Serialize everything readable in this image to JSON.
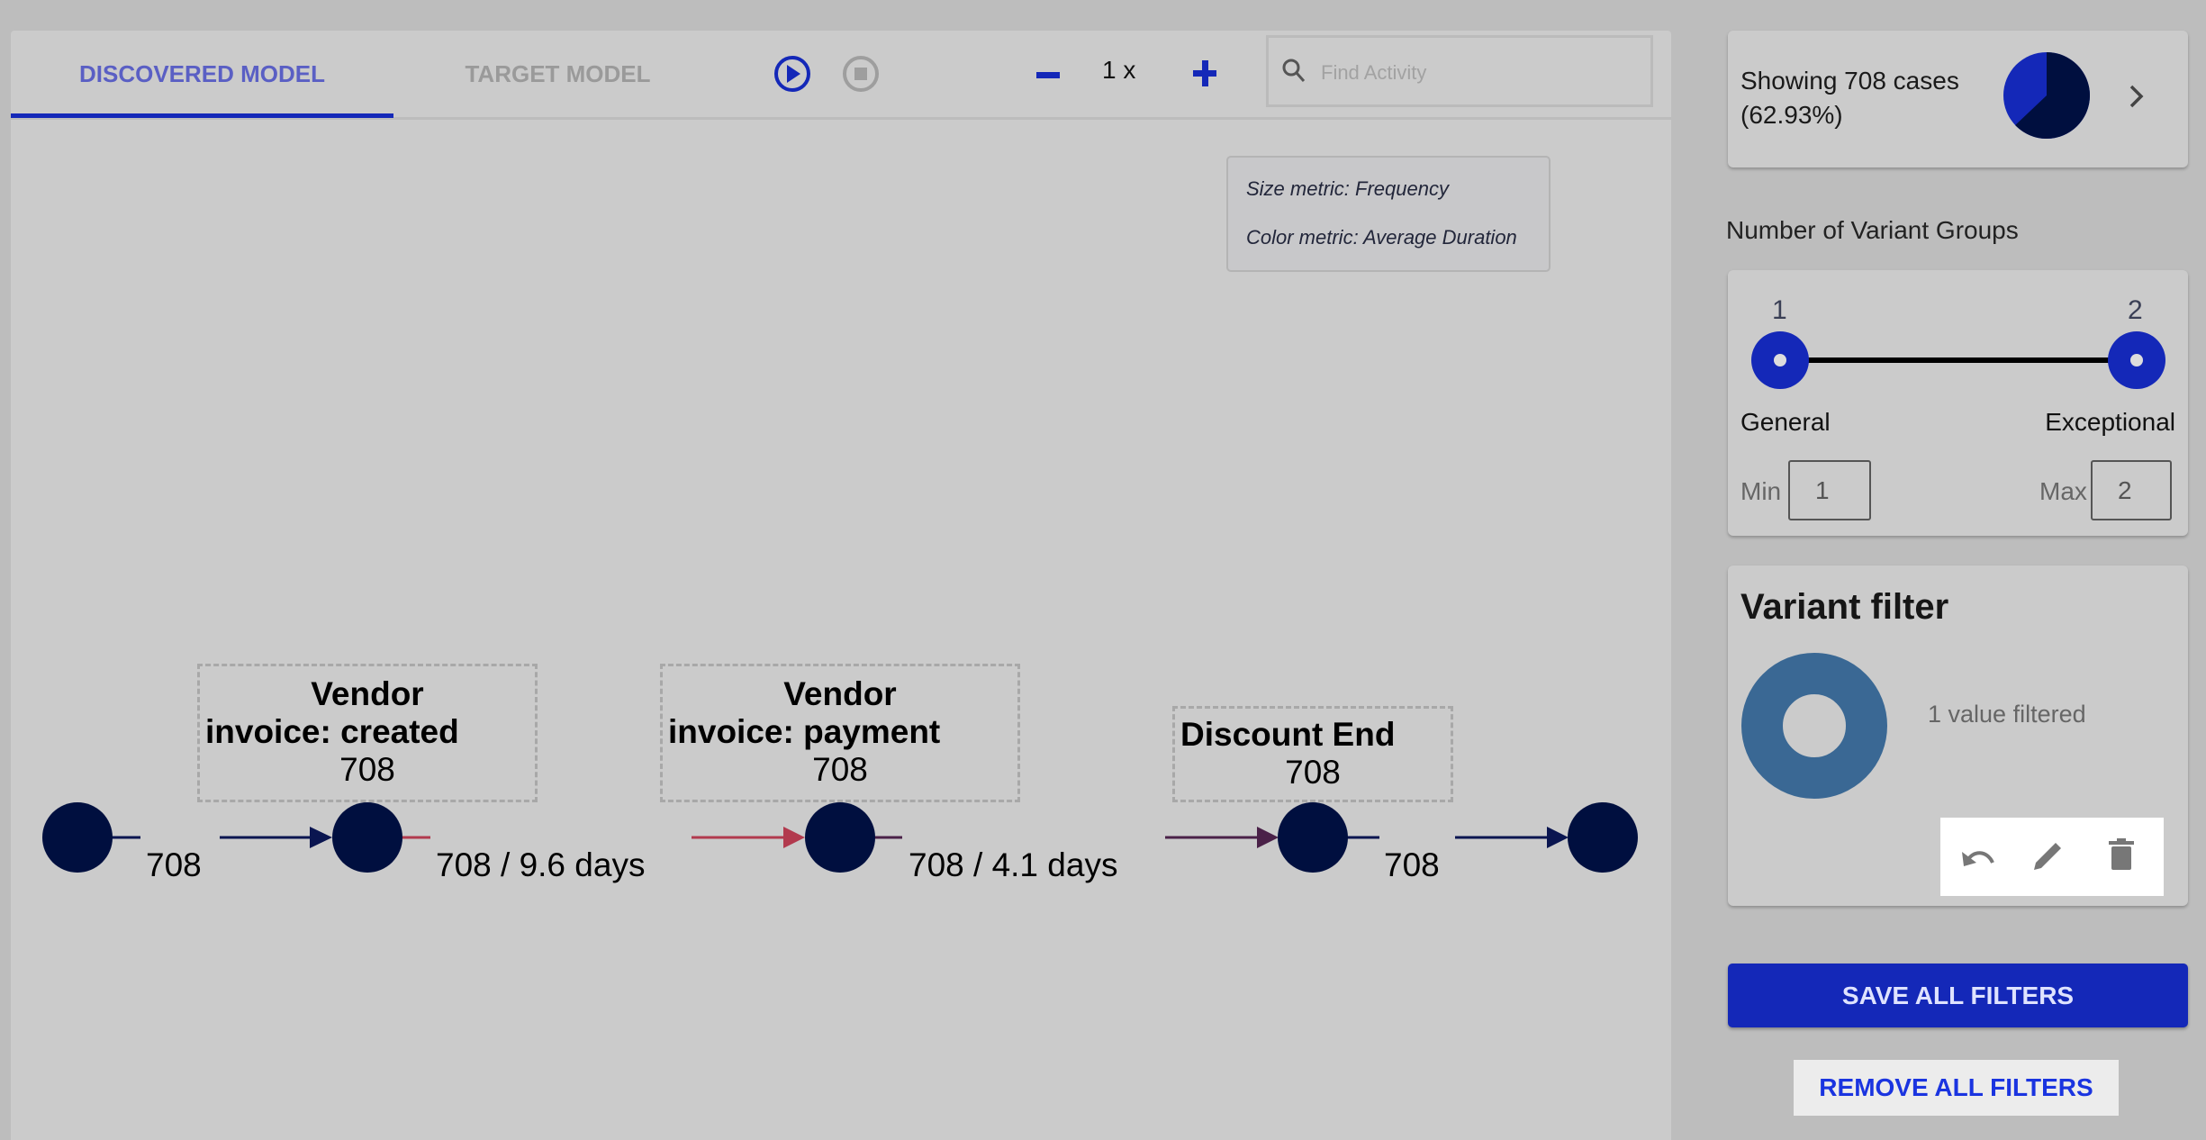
{
  "tabs": [
    {
      "label": "DISCOVERED MODEL",
      "active": true
    },
    {
      "label": "TARGET MODEL",
      "active": false
    }
  ],
  "toolbar": {
    "play_icon": "play-circle-icon",
    "stop_icon": "stop-circle-icon",
    "zoom_out_icon": "minus-icon",
    "zoom_level": "1 x",
    "zoom_in_icon": "plus-icon",
    "search_placeholder": "Find Activity",
    "search_value": ""
  },
  "legend": {
    "size_metric": "Size metric: Frequency",
    "color_metric": "Color metric: Average Duration"
  },
  "graph": {
    "activities": [
      {
        "line1": "Vendor",
        "line2": "invoice: created",
        "count": "708"
      },
      {
        "line1": "Vendor",
        "line2": "invoice: payment",
        "count": "708"
      },
      {
        "line1": "Discount End",
        "line2": "",
        "count": "708"
      }
    ],
    "edges": [
      {
        "label": "708",
        "color": "#0a1550"
      },
      {
        "label": "708 / 9.6 days",
        "color": "#b23a4e"
      },
      {
        "label": "708 / 4.1 days",
        "color": "#4a2148"
      },
      {
        "label": "708",
        "color": "#0a1550"
      }
    ],
    "node_color": "#000f3f"
  },
  "cases": {
    "line1": "Showing 708 cases",
    "line2": "(62.93%)",
    "fraction": 0.6293,
    "chevron_icon": "chevron-right-icon",
    "colors": {
      "selected": "#000f3f",
      "rest": "#1428b8"
    }
  },
  "variant_groups": {
    "title": "Number of Variant Groups",
    "min_label_top": "1",
    "max_label_top": "2",
    "left_label": "General",
    "right_label": "Exceptional",
    "min_label": "Min",
    "min_value": "1",
    "max_label": "Max",
    "max_value": "2"
  },
  "variant_filter": {
    "title": "Variant filter",
    "status": "1 value filtered",
    "donut_color": "#3a6894",
    "actions": [
      "undo-icon",
      "edit-icon",
      "delete-icon"
    ]
  },
  "buttons": {
    "save": "SAVE ALL FILTERS",
    "remove": "REMOVE ALL FILTERS"
  },
  "colors": {
    "accent": "#1428b8",
    "panel": "#cbcbcb",
    "background": "#bdbdbd"
  }
}
